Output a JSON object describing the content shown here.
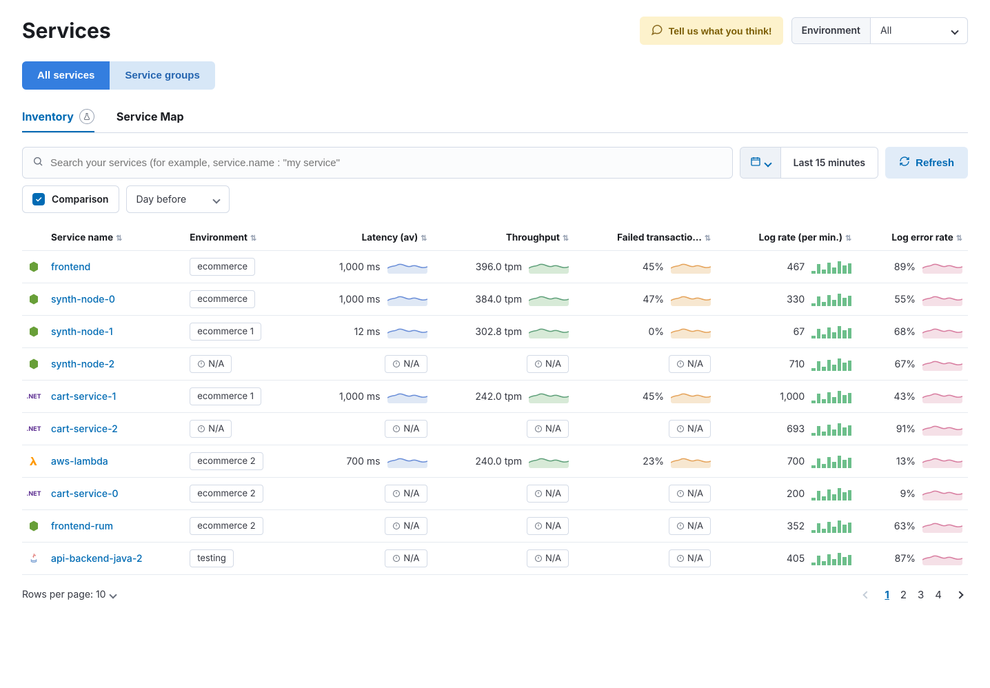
{
  "page": {
    "title": "Services"
  },
  "header": {
    "feedback": "Tell us what you think!",
    "env_label": "Environment",
    "env_value": "All"
  },
  "tabs": {
    "all": "All services",
    "groups": "Service groups"
  },
  "subtabs": {
    "inventory": "Inventory",
    "service_map": "Service Map"
  },
  "filters": {
    "search_placeholder": "Search your services (for example, service.name : \"my service\"",
    "date_range": "Last 15 minutes",
    "refresh": "Refresh",
    "comparison_label": "Comparison",
    "comparison_value": "Day before"
  },
  "columns": {
    "service": "Service name",
    "env": "Environment",
    "latency": "Latency (av)",
    "throughput": "Throughput",
    "failed": "Failed transactio...",
    "lograte": "Log rate (per min.)",
    "logerr": "Log error rate"
  },
  "na": "N/A",
  "rows": [
    {
      "name": "frontend",
      "icon": "node",
      "env": "ecommerce",
      "latency": "1,000 ms",
      "throughput": "396.0 tpm",
      "failed": "45%",
      "lograte": "467",
      "logerr": "89%"
    },
    {
      "name": "synth-node-0",
      "icon": "node",
      "env": "ecommerce",
      "latency": "1,000 ms",
      "throughput": "384.0 tpm",
      "failed": "47%",
      "lograte": "330",
      "logerr": "55%"
    },
    {
      "name": "synth-node-1",
      "icon": "node",
      "env": "ecommerce 1",
      "latency": "12 ms",
      "throughput": "302.8 tpm",
      "failed": "0%",
      "lograte": "67",
      "logerr": "68%"
    },
    {
      "name": "synth-node-2",
      "icon": "node",
      "env": null,
      "latency": null,
      "throughput": null,
      "failed": null,
      "lograte": "710",
      "logerr": "67%"
    },
    {
      "name": "cart-service-1",
      "icon": "dotnet",
      "env": "ecommerce 1",
      "latency": "1,000 ms",
      "throughput": "242.0 tpm",
      "failed": "45%",
      "lograte": "1,000",
      "logerr": "43%"
    },
    {
      "name": "cart-service-2",
      "icon": "dotnet",
      "env": null,
      "latency": null,
      "throughput": null,
      "failed": null,
      "lograte": "693",
      "logerr": "91%"
    },
    {
      "name": "aws-lambda",
      "icon": "lambda",
      "env": "ecommerce 2",
      "latency": "700 ms",
      "throughput": "240.0 tpm",
      "failed": "23%",
      "lograte": "700",
      "logerr": "13%"
    },
    {
      "name": "cart-service-0",
      "icon": "dotnet",
      "env": "ecommerce 2",
      "latency": null,
      "throughput": null,
      "failed": null,
      "lograte": "200",
      "logerr": "9%"
    },
    {
      "name": "frontend-rum",
      "icon": "node",
      "env": "ecommerce 2",
      "latency": null,
      "throughput": null,
      "failed": null,
      "lograte": "352",
      "logerr": "63%"
    },
    {
      "name": "api-backend-java-2",
      "icon": "java",
      "env": "testing",
      "latency": null,
      "throughput": null,
      "failed": null,
      "lograte": "405",
      "logerr": "87%"
    }
  ],
  "footer": {
    "rows_per": "Rows per page: 10"
  },
  "pager": {
    "pages": [
      "1",
      "2",
      "3",
      "4"
    ],
    "active": 0
  },
  "spark_colors": {
    "latency": "#6a8ed8",
    "latency_fill": "#dfe8f5",
    "throughput": "#5fa07a",
    "throughput_fill": "#d7ead7",
    "failed": "#e5a35a",
    "failed_fill": "#f7e7d0",
    "logerr": "#d87da0",
    "logerr_fill": "#f5e0e7"
  }
}
